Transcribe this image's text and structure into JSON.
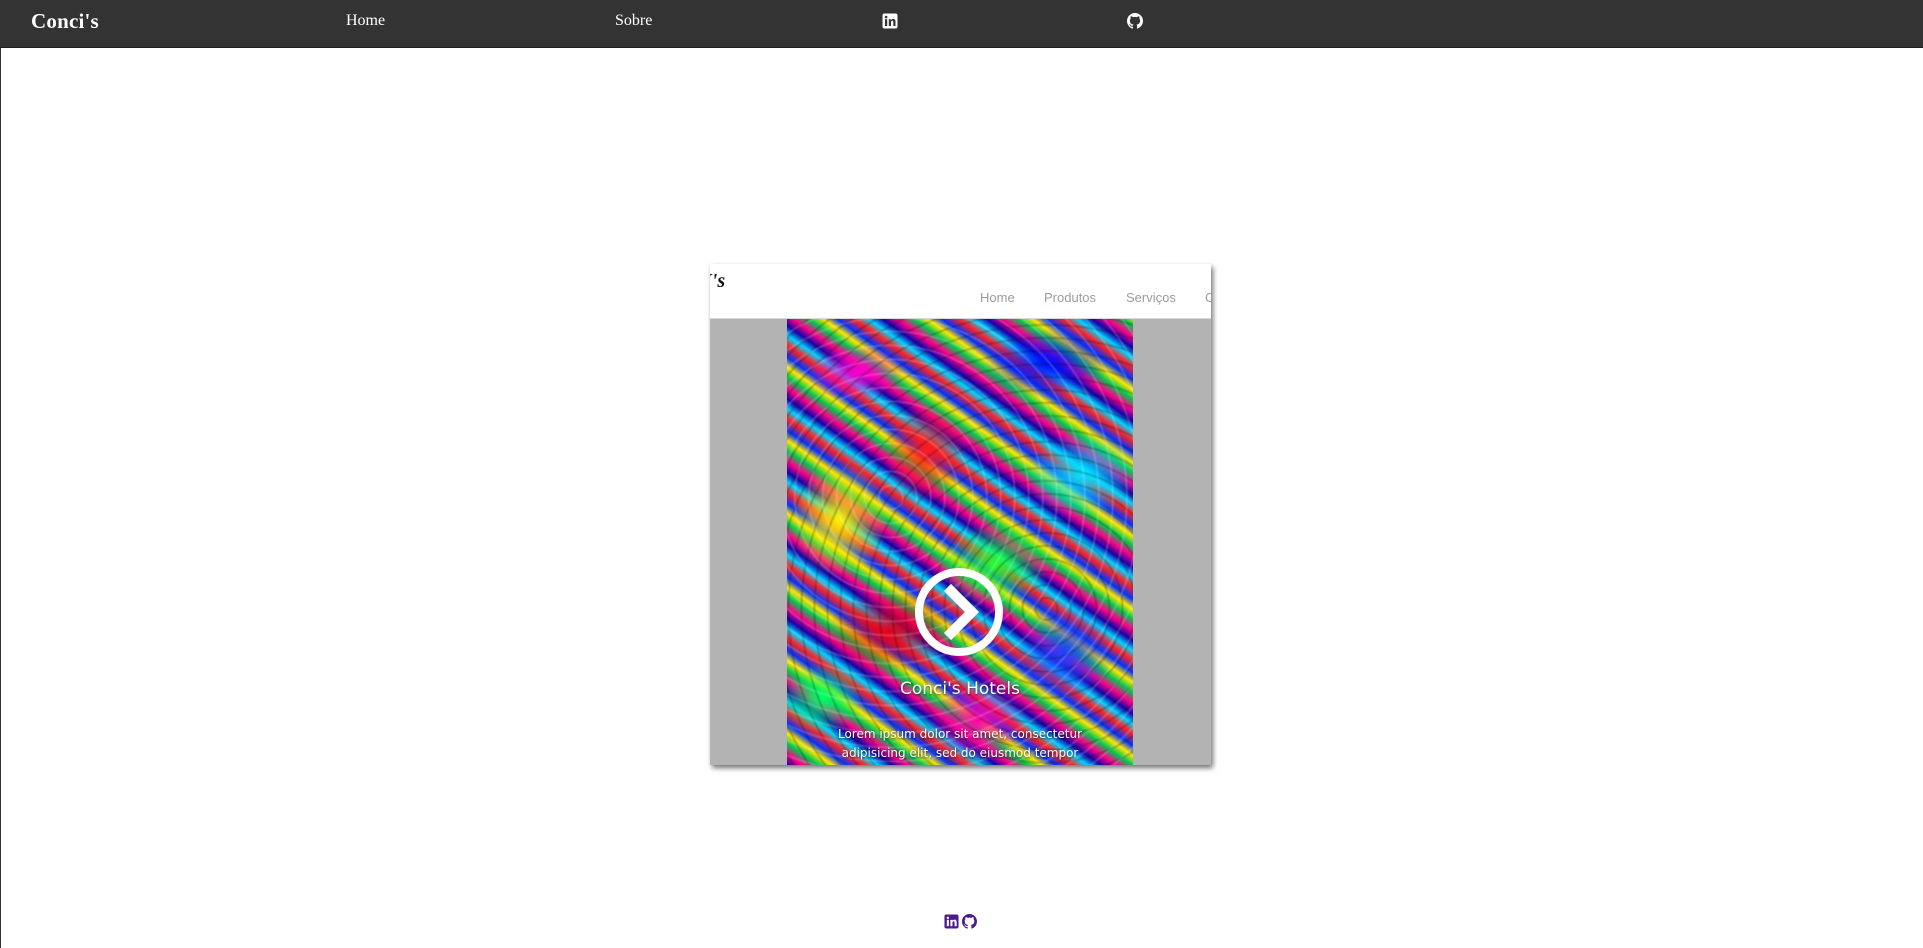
{
  "header": {
    "brand": "Conci's",
    "nav": {
      "home": "Home",
      "sobre": "Sobre"
    },
    "icons": {
      "linkedin": "linkedin-icon",
      "github": "github-icon"
    },
    "background_color": "#333333"
  },
  "preview": {
    "logo": "I's",
    "nav": {
      "home": "Home",
      "produtos": "Produtos",
      "servicos": "Serviços",
      "partial": "C"
    },
    "hero": {
      "title": "Conci's Hotels",
      "text": "Lorem ipsum dolor sit amet, consectetur adipisicing elit, sed do eiusmod tempor",
      "arrow_icon": "chevron-right-circle-icon"
    }
  },
  "footer": {
    "icons": {
      "linkedin": "linkedin-icon",
      "github": "github-icon"
    },
    "icon_color": "#4b1a8c"
  }
}
